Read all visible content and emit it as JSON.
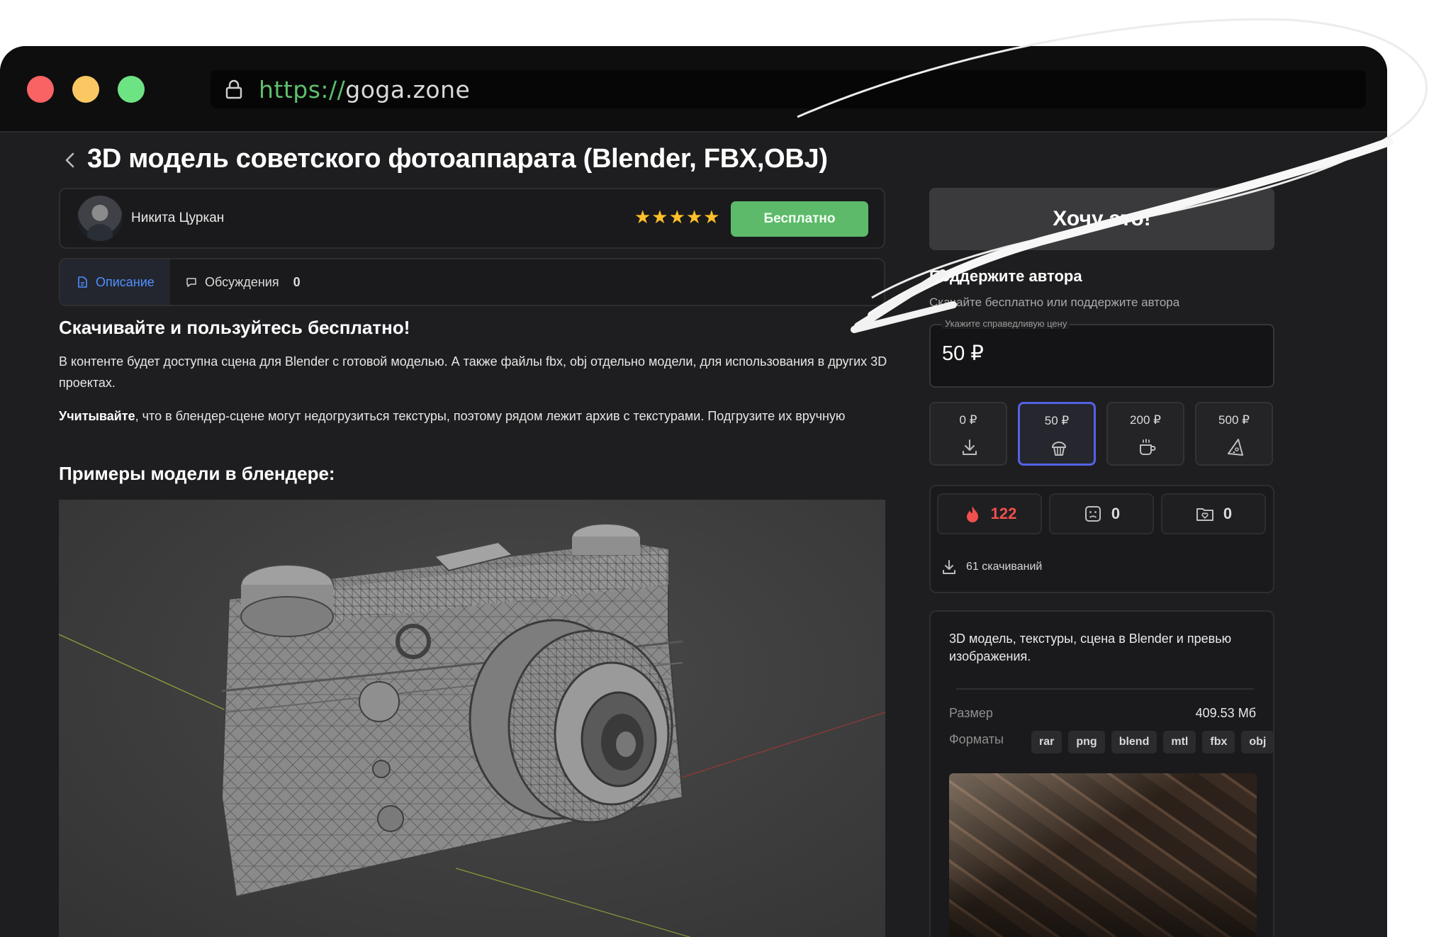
{
  "browser": {
    "url_scheme": "https://",
    "url_host": "goga.zone"
  },
  "page": {
    "title": "3D модель советского фотоаппарата (Blender, FBX,OBJ)"
  },
  "author": {
    "name": "Никита Цуркан",
    "stars": "★★★★★",
    "price_badge": "Бесплатно"
  },
  "tabs": [
    {
      "label": "Описание"
    },
    {
      "label": "Обсуждения",
      "count": "0"
    }
  ],
  "content": {
    "heading1": "Скачивайте и пользуйтесь бесплатно!",
    "para1": "В контенте будет доступна сцена для Blender с готовой моделью. А также файлы fbx, obj отдельно модели, для использования в других 3D проектах.",
    "para2_bold": "Учитывайте",
    "para2_rest": ", что в блендер-сцене могут недогрузиться текстуры, поэтому рядом лежит архив с текстурами. Подгрузите их вручную",
    "heading2": "Примеры модели в блендере:"
  },
  "sidebar": {
    "want_button": "Хочу это!",
    "support_title": "Поддержите автора",
    "support_subtitle": "Скачайте бесплатно или поддержите автора",
    "price_hint": "Укажите справедливую цену",
    "price_value": "50 ₽",
    "tiers": [
      {
        "label": "0 ₽",
        "icon": "download-icon"
      },
      {
        "label": "50 ₽",
        "icon": "cupcake-icon",
        "selected": true
      },
      {
        "label": "200 ₽",
        "icon": "coffee-icon"
      },
      {
        "label": "500 ₽",
        "icon": "pizza-icon"
      }
    ],
    "stats": {
      "likes": "122",
      "saves": "0",
      "folders": "0",
      "downloads": "61 скачиваний"
    },
    "info": {
      "description": "3D модель, текстуры, сцена в Blender и превью изображения.",
      "size_label": "Размер",
      "size_value": "409.53 Мб",
      "formats_label": "Форматы",
      "formats": [
        "rar",
        "png",
        "blend",
        "mtl",
        "fbx",
        "obj"
      ]
    }
  },
  "colors": {
    "accent_green": "#5dba6a",
    "accent_blue": "#4f90ff",
    "selected_border": "#5462e5",
    "likes_red": "#f0504c",
    "stars": "#ffc02a"
  }
}
